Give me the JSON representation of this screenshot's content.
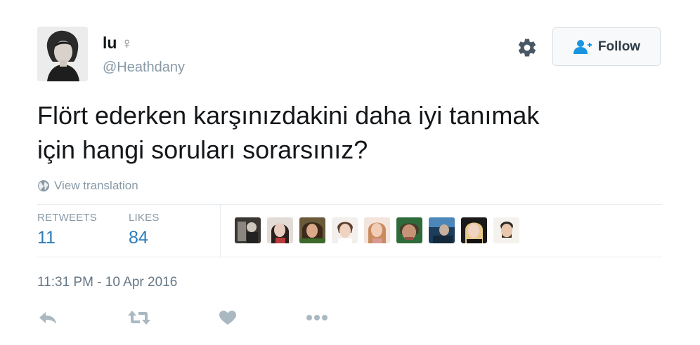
{
  "user": {
    "display_name": "lu",
    "name_symbol": "♀",
    "username": "@Heathdany"
  },
  "header": {
    "follow_label": "Follow"
  },
  "tweet": {
    "text_lines": [
      "Flört ederken karşınızdakini daha iyi tanımak",
      "için hangi soruları sorarsınız?"
    ],
    "translate_label": "View translation"
  },
  "stats": {
    "retweets_label": "RETWEETS",
    "retweets_count": "11",
    "likes_label": "LIKES",
    "likes_count": "84"
  },
  "timestamp": "11:31 PM - 10 Apr 2016",
  "icons": {
    "gear": "gear-icon",
    "follow": "follow-person-icon",
    "globe": "globe-icon",
    "reply": "reply-icon",
    "retweet": "retweet-icon",
    "like": "heart-icon",
    "more": "more-dots-icon"
  },
  "colors": {
    "link_blue": "#2b7bb9",
    "muted_gray": "#8899a6",
    "action_gray": "#aab8c2",
    "follow_icon_blue": "#1b95e0"
  }
}
